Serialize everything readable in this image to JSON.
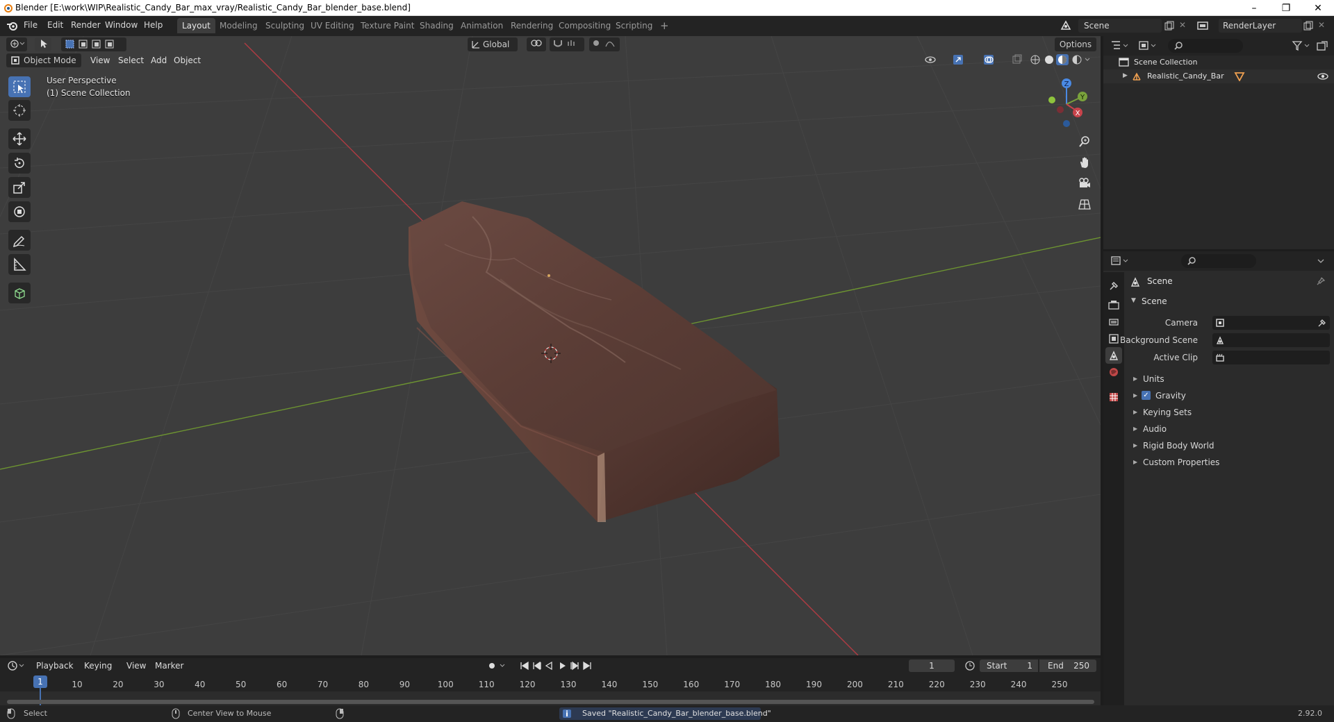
{
  "window": {
    "title": "Blender [E:\\work\\WIP\\Realistic_Candy_Bar_max_vray/Realistic_Candy_Bar_blender_base.blend]",
    "minimize": "–",
    "maximize": "❐",
    "close": "✕"
  },
  "menus": [
    "File",
    "Edit",
    "Render",
    "Window",
    "Help"
  ],
  "workspaces": [
    "Layout",
    "Modeling",
    "Sculpting",
    "UV Editing",
    "Texture Paint",
    "Shading",
    "Animation",
    "Rendering",
    "Compositing",
    "Scripting"
  ],
  "add_workspace": "+",
  "scene_selector": "Scene",
  "layer_selector": "RenderLayer",
  "viewport": {
    "mode": "Object Mode",
    "menus": [
      "View",
      "Select",
      "Add",
      "Object"
    ],
    "orientation": "Global",
    "options": "Options",
    "overlay_line1": "User Perspective",
    "overlay_line2": "(1) Scene Collection",
    "gizmo": {
      "z": "Z",
      "y": "Y",
      "x": "X"
    }
  },
  "outliner": {
    "root": "Scene Collection",
    "items": [
      {
        "name": "Realistic_Candy_Bar"
      }
    ]
  },
  "properties": {
    "context": "Scene",
    "panel": "Scene",
    "fields": [
      {
        "label": "Camera"
      },
      {
        "label": "Background Scene"
      },
      {
        "label": "Active Clip"
      }
    ],
    "subpanels": [
      "Units",
      "Gravity",
      "Keying Sets",
      "Audio",
      "Rigid Body World",
      "Custom Properties"
    ],
    "gravity_checked": true
  },
  "timeline": {
    "menus": [
      "Playback",
      "Keying",
      "View",
      "Marker"
    ],
    "current_frame": "1",
    "start_label": "Start",
    "start_value": "1",
    "end_label": "End",
    "end_value": "250",
    "ticks": [
      "1",
      "10",
      "20",
      "30",
      "40",
      "50",
      "60",
      "70",
      "80",
      "90",
      "100",
      "110",
      "120",
      "130",
      "140",
      "150",
      "160",
      "170",
      "180",
      "190",
      "200",
      "210",
      "220",
      "230",
      "240",
      "250"
    ]
  },
  "statusbar": {
    "select": "Select",
    "center_view": "Center View to Mouse",
    "message": "Saved \"Realistic_Candy_Bar_blender_base.blend\"",
    "version": "2.92.0"
  },
  "colors": {
    "accent": "#4772b3",
    "axis_x": "#c8434b",
    "axis_y": "#7aa23c",
    "axis_z": "#4a8ae4",
    "candy": "#5a3a33"
  }
}
